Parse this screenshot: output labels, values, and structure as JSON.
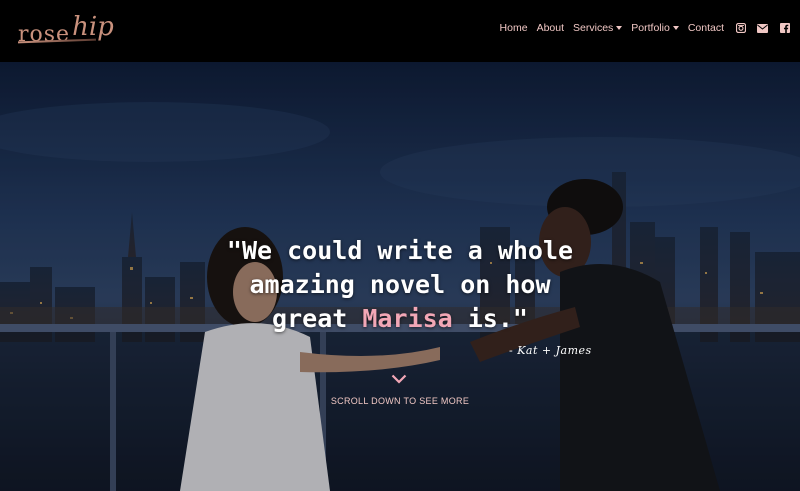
{
  "brand": {
    "logo_text_a": "rose",
    "logo_text_b": "hip"
  },
  "nav": {
    "items": [
      {
        "label": "Home"
      },
      {
        "label": "About"
      },
      {
        "label": "Services"
      },
      {
        "label": "Portfolio"
      },
      {
        "label": "Contact"
      }
    ],
    "icons": [
      "instagram-icon",
      "mail-icon",
      "facebook-icon"
    ]
  },
  "hero": {
    "quote_line1": "\"We could write a whole",
    "quote_line2": "amazing novel on how",
    "quote_line3_pre": "great ",
    "quote_highlight": "Marisa",
    "quote_line3_post": " is.\"",
    "signature": "- Kat + James",
    "scroll_label": "SCROLL DOWN TO SEE MORE"
  },
  "colors": {
    "accent_pink": "#f2a7b6",
    "nav_text": "#f0c7c4",
    "logo": "#c9917d",
    "header_bg": "#000000"
  }
}
